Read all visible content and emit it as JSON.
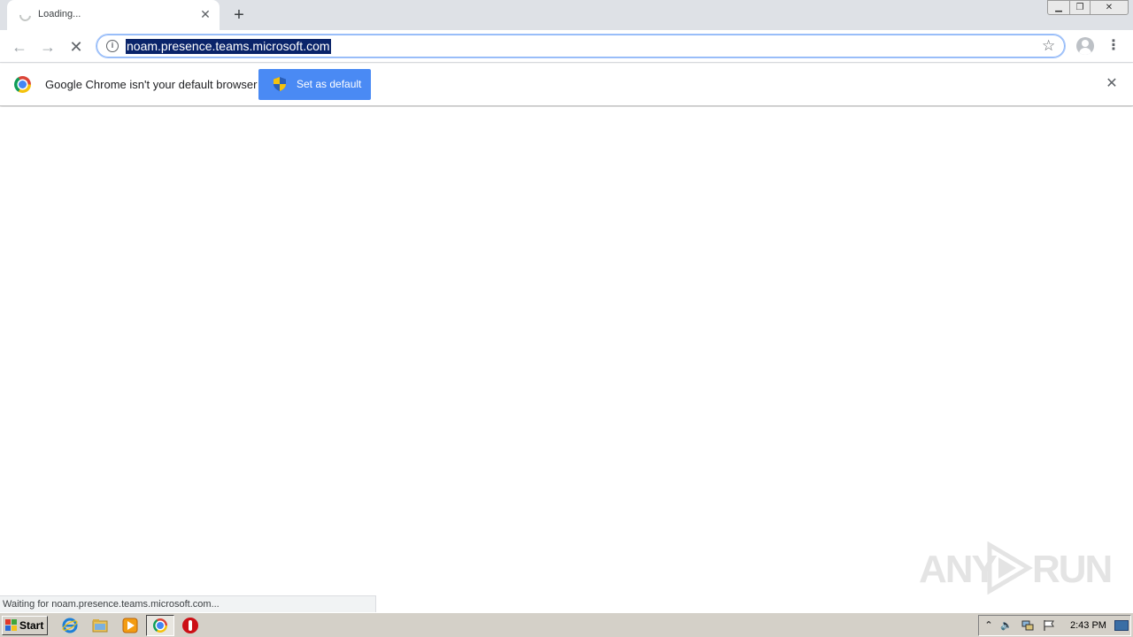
{
  "tab": {
    "title": "Loading...",
    "close_glyph": "✕"
  },
  "new_tab_glyph": "+",
  "window_controls": {
    "minimize": "▁",
    "maximize": "❐",
    "close": "✕"
  },
  "toolbar": {
    "back_glyph": "←",
    "forward_glyph": "→",
    "stop_glyph": "✕",
    "info_glyph": "i",
    "url": "noam.presence.teams.microsoft.com",
    "star_glyph": "☆",
    "menu_glyph": "⋮"
  },
  "infobar": {
    "message": "Google Chrome isn't your default browser",
    "button_label": "Set as default",
    "close_glyph": "✕"
  },
  "status_bubble": "Waiting for noam.presence.teams.microsoft.com...",
  "watermark": {
    "left": "ANY",
    "right": "RUN"
  },
  "taskbar": {
    "start_label": "Start",
    "tray_up_glyph": "⌃",
    "volume_glyph": "🔈",
    "clock": "2:43 PM"
  },
  "colors": {
    "button_blue": "#4a8af4",
    "url_highlight": "#0a246a",
    "tabstrip": "#dee1e6",
    "taskbar": "#d4d0c8"
  },
  "icons": [
    "loading-spinner-icon",
    "close-icon",
    "plus-icon",
    "back-arrow-icon",
    "forward-arrow-icon",
    "stop-icon",
    "info-icon",
    "star-icon",
    "profile-avatar-icon",
    "kebab-menu-icon",
    "chrome-logo-icon",
    "uac-shield-icon",
    "windows-logo-icon",
    "internet-explorer-icon",
    "folder-icon",
    "media-player-icon",
    "opera-icon",
    "speaker-icon",
    "network-icon",
    "flag-icon"
  ]
}
